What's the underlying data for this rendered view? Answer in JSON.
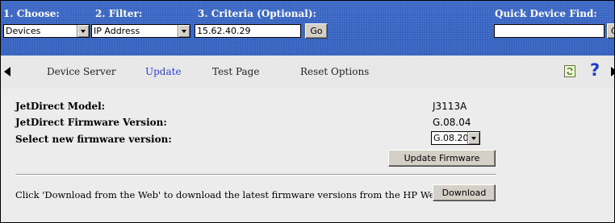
{
  "filter_bar": {
    "choose_label": "1. Choose:",
    "choose_value": "Devices",
    "filter_label": "2. Filter:",
    "filter_value": "IP Address",
    "criteria_label": "3. Criteria (Optional):",
    "criteria_value": "15.62.40.29",
    "go_label": "Go",
    "quick_find_label": "Quick Device Find:",
    "quick_find_value": "",
    "quick_go_label": "Go"
  },
  "nav": {
    "items": [
      {
        "label": "Device Server",
        "active": false
      },
      {
        "label": "Update",
        "active": true
      },
      {
        "label": "Test Page",
        "active": false
      },
      {
        "label": "Reset Options",
        "active": false
      }
    ],
    "help_glyph": "?",
    "icons": [
      "scroll-left-icon",
      "refresh-icon",
      "help-icon",
      "scroll-right-icon"
    ]
  },
  "main": {
    "model_label": "JetDirect Model:",
    "model_value": "J3113A",
    "firmware_label": "JetDirect Firmware Version:",
    "firmware_value": "G.08.04",
    "select_label": "Select new firmware version:",
    "select_value": "G.08.20",
    "update_button": "Update Firmware",
    "download_note": "Click 'Download from the Web' to download the latest firmware versions from the HP Web Site.",
    "download_button": "Download"
  },
  "colors": {
    "topbar": "#3a67c2",
    "active_link": "#2f3fd6",
    "help_icon": "#1f3fc8"
  }
}
